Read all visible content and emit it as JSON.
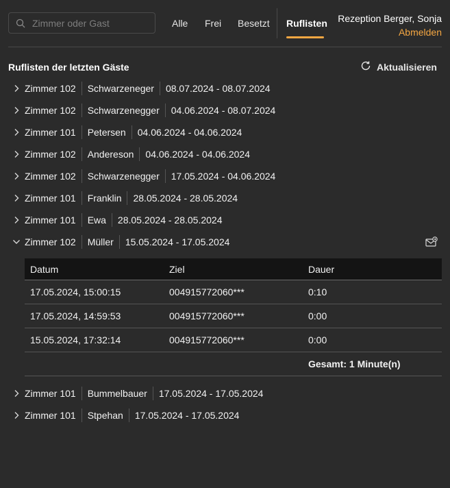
{
  "search": {
    "placeholder": "Zimmer oder Gast"
  },
  "nav": {
    "tabs": [
      {
        "label": "Alle"
      },
      {
        "label": "Frei"
      },
      {
        "label": "Besetzt"
      },
      {
        "label": "Ruflisten"
      }
    ],
    "active_tab": "Ruflisten"
  },
  "user": {
    "name": "Rezeption Berger, Sonja",
    "logout": "Abmelden"
  },
  "section": {
    "title": "Ruflisten der letzten Gäste",
    "refresh_label": "Aktualisieren"
  },
  "accent_color": "#f5a742",
  "rows": [
    {
      "room": "Zimmer 102",
      "guest": "Schwarzeneger",
      "period": "08.07.2024 - 08.07.2024",
      "expanded": false
    },
    {
      "room": "Zimmer 102",
      "guest": "Schwarzenegger",
      "period": "04.06.2024 - 08.07.2024",
      "expanded": false
    },
    {
      "room": "Zimmer 101",
      "guest": "Petersen",
      "period": "04.06.2024 - 04.06.2024",
      "expanded": false
    },
    {
      "room": "Zimmer 102",
      "guest": "Andereson",
      "period": "04.06.2024 - 04.06.2024",
      "expanded": false
    },
    {
      "room": "Zimmer 102",
      "guest": "Schwarzenegger",
      "period": "17.05.2024 - 04.06.2024",
      "expanded": false
    },
    {
      "room": "Zimmer 101",
      "guest": "Franklin",
      "period": "28.05.2024 - 28.05.2024",
      "expanded": false
    },
    {
      "room": "Zimmer 101",
      "guest": "Ewa",
      "period": "28.05.2024 - 28.05.2024",
      "expanded": false
    },
    {
      "room": "Zimmer 102",
      "guest": "Müller",
      "period": "15.05.2024 - 17.05.2024",
      "expanded": true
    },
    {
      "room": "Zimmer 101",
      "guest": "Bummelbauer",
      "period": "17.05.2024 - 17.05.2024",
      "expanded": false
    },
    {
      "room": "Zimmer 101",
      "guest": "Stpehan",
      "period": "17.05.2024 - 17.05.2024",
      "expanded": false
    }
  ],
  "calls": {
    "headers": {
      "date": "Datum",
      "target": "Ziel",
      "duration": "Dauer"
    },
    "rows": [
      {
        "date": "17.05.2024, 15:00:15",
        "target": "004915772060***",
        "duration": "0:10"
      },
      {
        "date": "17.05.2024, 14:59:53",
        "target": "004915772060***",
        "duration": "0:00"
      },
      {
        "date": "15.05.2024, 17:32:14",
        "target": "004915772060***",
        "duration": "0:00"
      }
    ],
    "total": "Gesamt: 1 Minute(n)"
  },
  "icons": {
    "search": "search-icon",
    "refresh": "refresh-icon",
    "chevron_right": "chevron-right-icon",
    "chevron_down": "chevron-down-icon",
    "mail": "mail-icon"
  }
}
